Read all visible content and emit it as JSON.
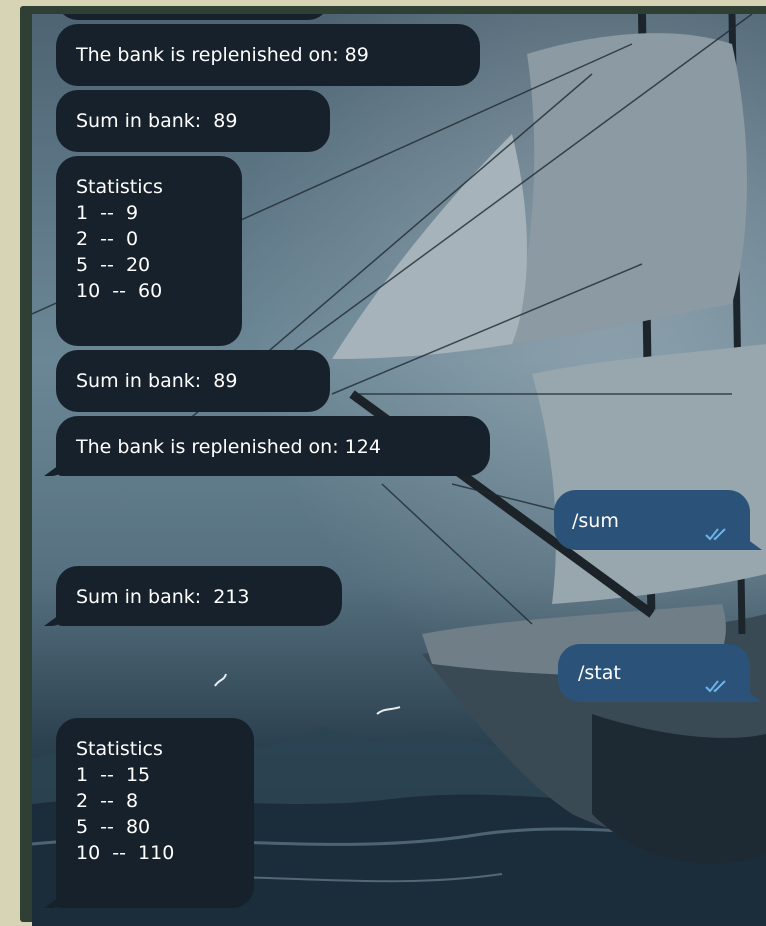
{
  "messages": {
    "m1": {
      "text": "The bank is replenished on: 89"
    },
    "m2": {
      "text": "Sum in bank:  89"
    },
    "m3": {
      "lines": [
        "Statistics",
        "1  --  9",
        "2  --  0",
        "5  --  20",
        "10  --  60"
      ]
    },
    "m4": {
      "text": "Sum in bank:  89"
    },
    "m5": {
      "text": "The bank is replenished on: 124"
    },
    "m6": {
      "text": "/sum",
      "status": "read-double-check-icon"
    },
    "m7": {
      "text": "Sum in bank:  213"
    },
    "m8": {
      "text": "/stat",
      "status": "read-double-check-icon"
    },
    "m9": {
      "lines": [
        "Statistics",
        "1  --  15",
        "2  --  8",
        "5  --  80",
        "10  --  110"
      ]
    }
  },
  "colors": {
    "incoming_bubble": "#17212b",
    "outgoing_bubble": "#2b5278",
    "text": "#ffffff",
    "check_marks": "#6fb3e8",
    "outer_background": "#d6d4b4",
    "frame": "#2f3f34"
  }
}
